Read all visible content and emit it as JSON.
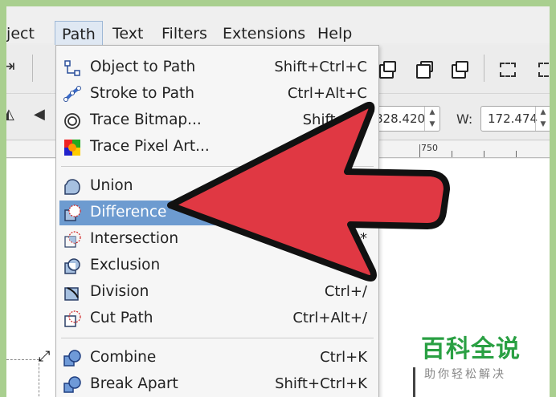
{
  "menubar": {
    "items": [
      "bject",
      "Path",
      "Text",
      "Filters",
      "Extensions",
      "Help"
    ],
    "active": "Path"
  },
  "toolbar": {
    "x_value": "828.420",
    "w_label": "W:",
    "w_value": "172.474"
  },
  "ruler": {
    "label": "750"
  },
  "path_menu": {
    "items": [
      {
        "label": "Object to Path",
        "shortcut": "Shift+Ctrl+C",
        "icon": "object-to-path-icon"
      },
      {
        "label": "Stroke to Path",
        "shortcut": "Ctrl+Alt+C",
        "icon": "stroke-to-path-icon"
      },
      {
        "label": "Trace Bitmap...",
        "shortcut": "Shift+Alt",
        "icon": "trace-bitmap-icon"
      },
      {
        "label": "Trace Pixel Art...",
        "shortcut": "",
        "icon": "trace-pixel-art-icon"
      },
      {
        "label": "Union",
        "shortcut": "",
        "icon": "union-icon"
      },
      {
        "label": "Difference",
        "shortcut": "",
        "icon": "difference-icon",
        "highlighted": true
      },
      {
        "label": "Intersection",
        "shortcut": "*",
        "icon": "intersection-icon"
      },
      {
        "label": "Exclusion",
        "shortcut": "",
        "icon": "exclusion-icon"
      },
      {
        "label": "Division",
        "shortcut": "Ctrl+/",
        "icon": "division-icon"
      },
      {
        "label": "Cut Path",
        "shortcut": "Ctrl+Alt+/",
        "icon": "cut-path-icon"
      },
      {
        "label": "Combine",
        "shortcut": "Ctrl+K",
        "icon": "combine-icon"
      },
      {
        "label": "Break Apart",
        "shortcut": "Shift+Ctrl+K",
        "icon": "break-apart-icon"
      }
    ]
  },
  "watermark": {
    "title": "百科全说",
    "subtitle": "助你轻松解决"
  },
  "colors": {
    "arrow": "#e03843",
    "highlight": "#6d9bd0",
    "border": "#a9cf8f",
    "watermark": "#2aa043"
  }
}
